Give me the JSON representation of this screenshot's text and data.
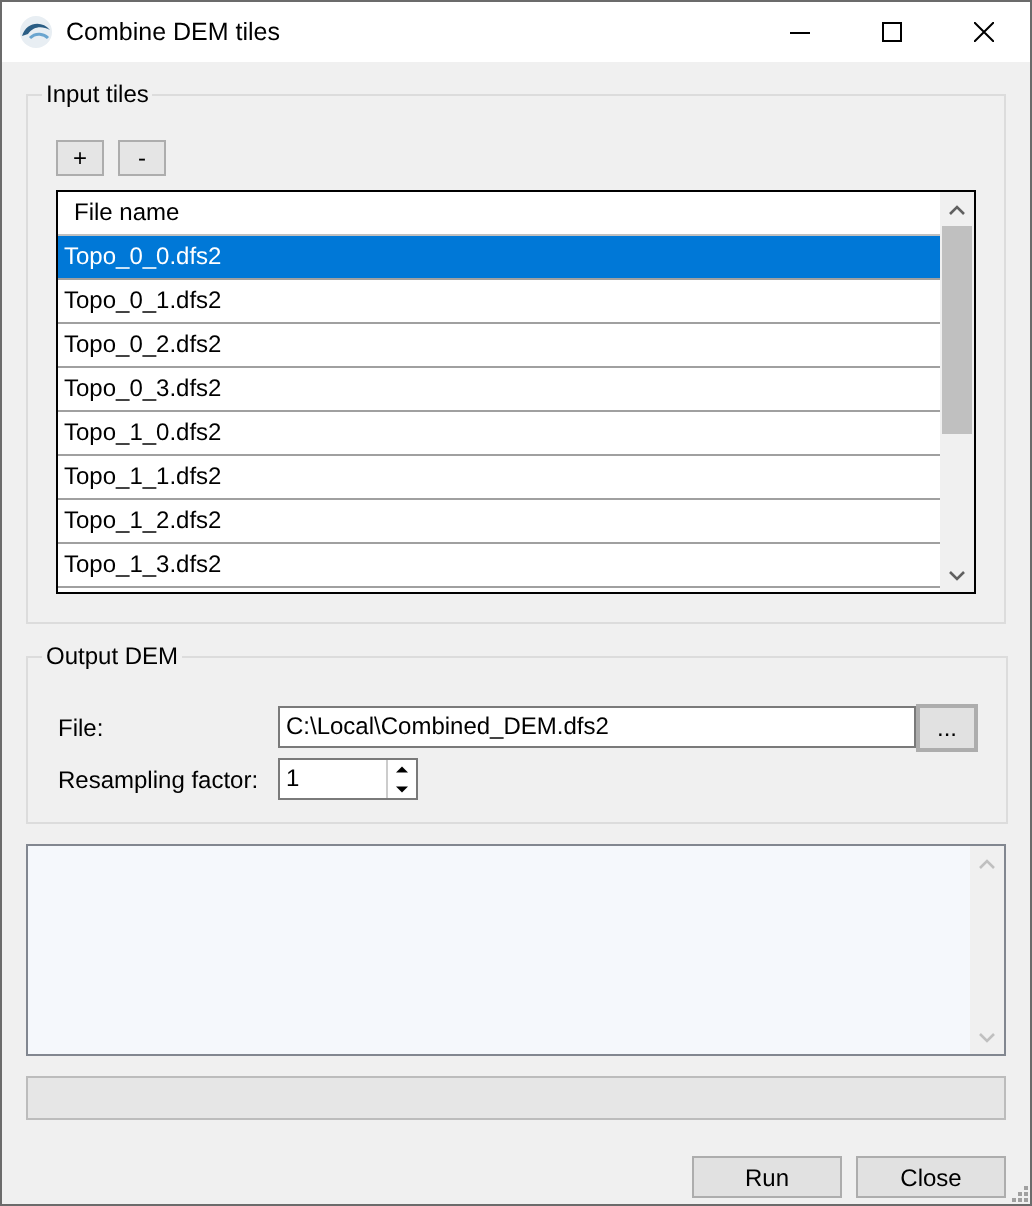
{
  "window": {
    "title": "Combine DEM tiles"
  },
  "input_tiles": {
    "title": "Input tiles",
    "buttons": [
      "+",
      "-"
    ],
    "list": {
      "column": "File name",
      "rows": [
        {
          "name": "Topo_0_0.dfs2",
          "selected": true
        },
        {
          "name": "Topo_0_1.dfs2",
          "selected": false
        },
        {
          "name": "Topo_0_2.dfs2",
          "selected": false
        },
        {
          "name": "Topo_0_3.dfs2",
          "selected": false
        },
        {
          "name": "Topo_1_0.dfs2",
          "selected": false
        },
        {
          "name": "Topo_1_1.dfs2",
          "selected": false
        },
        {
          "name": "Topo_1_2.dfs2",
          "selected": false
        },
        {
          "name": "Topo_1_3.dfs2",
          "selected": false
        }
      ]
    }
  },
  "output_dem": {
    "title": "Output DEM",
    "file_label": "File:",
    "file_value": "C:\\Local\\Combined_DEM.dfs2",
    "browse_button": "...",
    "resampling_label": "Resampling factor:",
    "resampling_value": "1"
  },
  "progress": {
    "level": 0
  },
  "buttons": [
    "Run",
    "Close"
  ]
}
